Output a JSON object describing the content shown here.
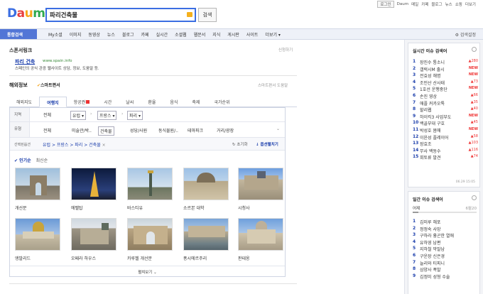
{
  "util_links": [
    "로그인",
    "Daum",
    "메일",
    "카페",
    "블로그",
    "뉴스",
    "쇼핑",
    "더보기"
  ],
  "logo": [
    "D",
    "a",
    "u",
    "m"
  ],
  "search": {
    "value": "파리건축물",
    "button": "검색"
  },
  "nav": {
    "all": "통합검색",
    "items": [
      "My소셜",
      "이미지",
      "동영상",
      "뉴스",
      "블로그",
      "카페",
      "실시간",
      "소셜웹",
      "웹문서",
      "지식",
      "게시판",
      "사이트",
      "더보기"
    ],
    "setting": "검색설정"
  },
  "sponsor": {
    "title": "스폰서링크",
    "apply": "신청하기",
    "ad_title": "파리 건축",
    "ad_url": "www.spain.info",
    "ad_desc": "스페인의 공식 관광 웹사이트 상담, 정보, 도움말 등."
  },
  "travel": {
    "title": "해외정보",
    "smart": "스마트편서",
    "help": "스마트편서 도움말",
    "tabs": [
      "해외지도",
      "여행지",
      "항공권",
      "시간",
      "날씨",
      "환율",
      "음식",
      "축제",
      "국가순위"
    ],
    "region_label": "지역",
    "region_all": "전체",
    "region_sel": [
      "유럽",
      "프랑스",
      "파리"
    ],
    "type_label": "유형",
    "type_all": "전체",
    "types": [
      "미술관/박..",
      "건축물",
      "성당/사원",
      "동식물원/..",
      "테마파크",
      "거리/광장"
    ],
    "crumb_label": "선택된옵션",
    "crumb": "유럽 > 프랑스 > 파리 > 건축물",
    "reset": "초기화",
    "option": "옵션펼치기",
    "sort_popular": "인기순",
    "sort_new": "최신순",
    "places": [
      "개선문",
      "에펠탑",
      "바스티유",
      "소르본 대학",
      "시청사",
      "앵발리드",
      "오페라 하우스",
      "카루젤 개선문",
      "퐁시에르주리",
      "판테옹"
    ],
    "more": "펼쳐보기"
  },
  "realtime": {
    "title": "실시간 이슈 검색어",
    "items": [
      {
        "rank": "1",
        "kw": "장진수 통소니",
        "chg": "280"
      },
      {
        "rank": "2",
        "kw": "갤럭시M 출시",
        "chg": "NEW"
      },
      {
        "rank": "3",
        "kw": "전효성 해명",
        "chg": "NEW"
      },
      {
        "rank": "4",
        "kw": "조민산 산사태",
        "chg": "73"
      },
      {
        "rank": "5",
        "kw": "1호선 운행중단",
        "chg": "NEW"
      },
      {
        "rank": "6",
        "kw": "손진 영상",
        "chg": "66"
      },
      {
        "rank": "7",
        "kw": "애플 커카오톡",
        "chg": "35"
      },
      {
        "rank": "8",
        "kw": "할리웹",
        "chg": "40"
      },
      {
        "rank": "9",
        "kw": "하이킥3 사업부도",
        "chg": "NEW"
      },
      {
        "rank": "10",
        "kw": "백골부대 구호",
        "chg": "45"
      },
      {
        "rank": "11",
        "kw": "박성호 몸매",
        "chg": "NEW"
      },
      {
        "rank": "12",
        "kw": "이윤성 플레이어",
        "chg": "58"
      },
      {
        "rank": "13",
        "kw": "장효조",
        "chg": "103"
      },
      {
        "rank": "14",
        "kw": "무사 백동수",
        "chg": "116"
      },
      {
        "rank": "15",
        "kw": "회토류 발견",
        "chg": "74"
      }
    ],
    "time": "06.29 15:05"
  },
  "daily": {
    "title": "일간 이슈 검색어",
    "left": "어제",
    "right": "6월20",
    "items": [
      {
        "rank": "1",
        "kw": "김미루 해포"
      },
      {
        "rank": "2",
        "kw": "정정숙 사망"
      },
      {
        "rank": "3",
        "kw": "구하라 흉곤한 열애"
      },
      {
        "rank": "4",
        "kw": "유하영 남편"
      },
      {
        "rank": "5",
        "kw": "지하철 막말남"
      },
      {
        "rank": "6",
        "kw": "구운장 신은경"
      },
      {
        "rank": "7",
        "kw": "늘리와 티피니"
      },
      {
        "rank": "8",
        "kw": "삼양사 폭발"
      },
      {
        "rank": "9",
        "kw": "김정미 성형 수술"
      }
    ]
  },
  "colors": {
    "accent": "#3b6ee2",
    "nav_active": "#5276d6",
    "link": "#1a3dab",
    "up": "#ee3333"
  }
}
